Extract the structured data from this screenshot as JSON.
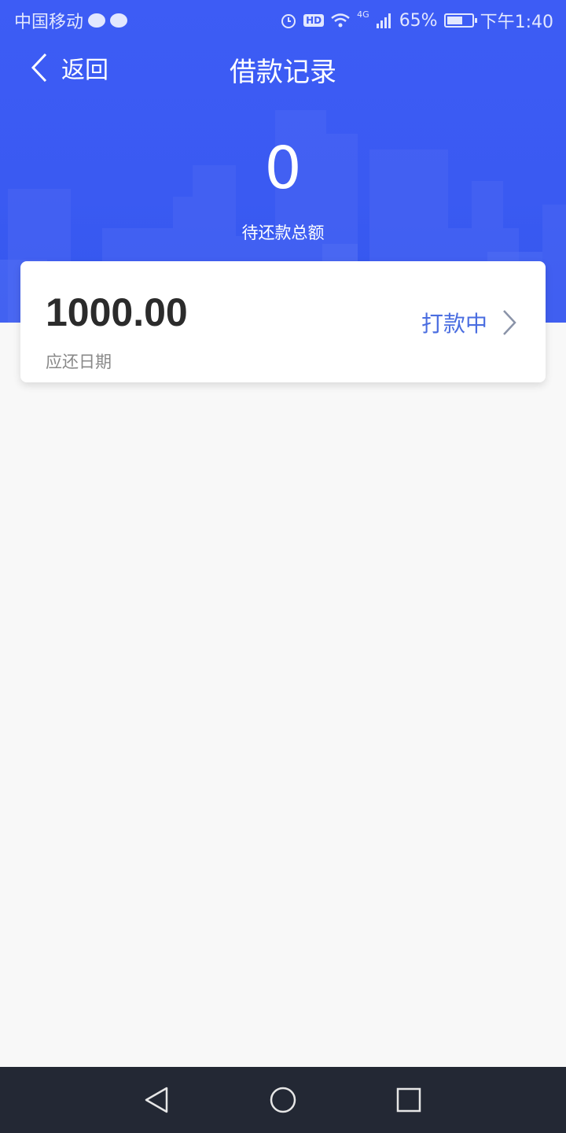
{
  "status_bar": {
    "carrier": "中国移动",
    "network": "4G",
    "battery_percent": "65%",
    "battery_level": 0.65,
    "time": "下午1:40"
  },
  "nav": {
    "back_label": "返回",
    "title": "借款记录"
  },
  "summary": {
    "total_due": "0",
    "total_due_label": "待还款总额"
  },
  "loans": [
    {
      "amount": "1000.00",
      "due_date_label": "应还日期",
      "status": "打款中"
    }
  ],
  "colors": {
    "accent": "#3d5cf5",
    "status_text": "#4a6de0",
    "nav_bar": "#232834"
  }
}
